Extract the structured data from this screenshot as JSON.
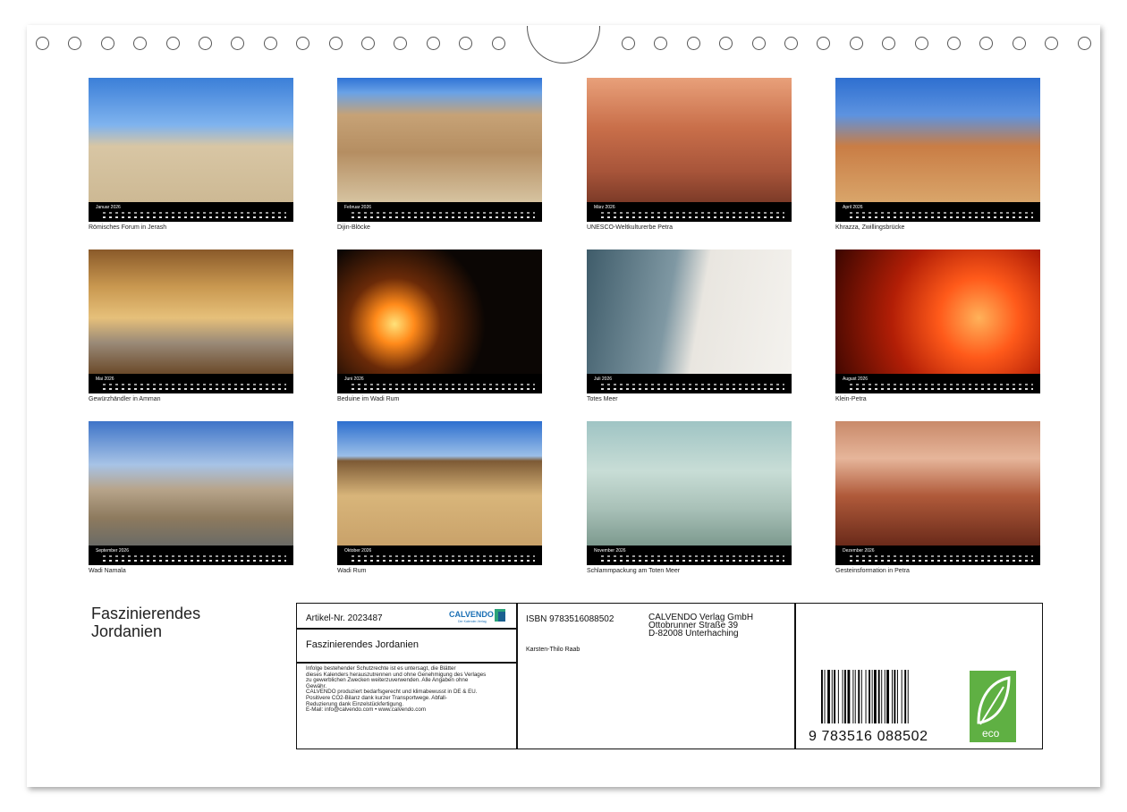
{
  "months": [
    {
      "month": "Januar 2026",
      "caption": "Römisches Forum in Jerash"
    },
    {
      "month": "Februar 2026",
      "caption": "Dijin-Blöcke"
    },
    {
      "month": "März 2026",
      "caption": "UNESCO-Weltkulturerbe Petra"
    },
    {
      "month": "April 2026",
      "caption": "Khrazza, Zwillingsbrücke"
    },
    {
      "month": "Mai 2026",
      "caption": "Gewürzhändler in Amman"
    },
    {
      "month": "Juni 2026",
      "caption": "Beduine im Wadi Rum"
    },
    {
      "month": "Juli 2026",
      "caption": "Totes Meer"
    },
    {
      "month": "August 2026",
      "caption": "Klein-Petra"
    },
    {
      "month": "September 2026",
      "caption": "Wadi Namala"
    },
    {
      "month": "Oktober 2026",
      "caption": "Wadi Rum"
    },
    {
      "month": "November 2026",
      "caption": "Schlammpackung am Toten Meer"
    },
    {
      "month": "Dezember 2026",
      "caption": "Gesteinsformation in Petra"
    }
  ],
  "title_line1": "Faszinierendes",
  "title_line2": "Jordanien",
  "info": {
    "article": "Artikel-Nr. 2023487",
    "logo_text": "CALVENDO",
    "logo_sub": "Der Kalender-Verlag",
    "product_title": "Faszinierendes Jordanien",
    "isbn": "ISBN 9783516088502",
    "author": "Karsten-Thilo Raab",
    "publisher": [
      "CALVENDO Verlag GmbH",
      "Ottobrunner Straße 39",
      "D-82008 Unterhaching"
    ],
    "legal": [
      "Infolge bestehender Schutzrechte ist es untersagt, die Blätter",
      "dieses Kalenders herauszutrennen und ohne Genehmigung des Verlages",
      "zu gewerblichen Zwecken weiterzuverwenden. Alle Angaben ohne",
      "Gewähr.",
      "CALVENDO produziert bedarfsgerecht und klimabewusst in DE & EU.",
      "Positivere CO2-Bilanz dank kurzer Transportwege. Abfall-",
      "Reduzierung dank Einzelstückfertigung.",
      "E-Mail: info@calvendo.com • www.calvendo.com"
    ],
    "barcode_number": "9 783516 088502",
    "eco_label": "eco"
  }
}
